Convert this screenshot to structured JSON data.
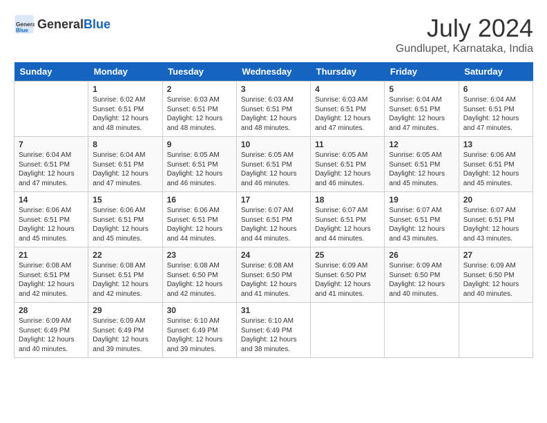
{
  "header": {
    "logo_general": "General",
    "logo_blue": "Blue",
    "month_year": "July 2024",
    "location": "Gundlupet, Karnataka, India"
  },
  "days_of_week": [
    "Sunday",
    "Monday",
    "Tuesday",
    "Wednesday",
    "Thursday",
    "Friday",
    "Saturday"
  ],
  "weeks": [
    [
      {
        "day": "",
        "content": ""
      },
      {
        "day": "1",
        "content": "Sunrise: 6:02 AM\nSunset: 6:51 PM\nDaylight: 12 hours\nand 48 minutes."
      },
      {
        "day": "2",
        "content": "Sunrise: 6:03 AM\nSunset: 6:51 PM\nDaylight: 12 hours\nand 48 minutes."
      },
      {
        "day": "3",
        "content": "Sunrise: 6:03 AM\nSunset: 6:51 PM\nDaylight: 12 hours\nand 48 minutes."
      },
      {
        "day": "4",
        "content": "Sunrise: 6:03 AM\nSunset: 6:51 PM\nDaylight: 12 hours\nand 47 minutes."
      },
      {
        "day": "5",
        "content": "Sunrise: 6:04 AM\nSunset: 6:51 PM\nDaylight: 12 hours\nand 47 minutes."
      },
      {
        "day": "6",
        "content": "Sunrise: 6:04 AM\nSunset: 6:51 PM\nDaylight: 12 hours\nand 47 minutes."
      }
    ],
    [
      {
        "day": "7",
        "content": "Sunrise: 6:04 AM\nSunset: 6:51 PM\nDaylight: 12 hours\nand 47 minutes."
      },
      {
        "day": "8",
        "content": "Sunrise: 6:04 AM\nSunset: 6:51 PM\nDaylight: 12 hours\nand 47 minutes."
      },
      {
        "day": "9",
        "content": "Sunrise: 6:05 AM\nSunset: 6:51 PM\nDaylight: 12 hours\nand 46 minutes."
      },
      {
        "day": "10",
        "content": "Sunrise: 6:05 AM\nSunset: 6:51 PM\nDaylight: 12 hours\nand 46 minutes."
      },
      {
        "day": "11",
        "content": "Sunrise: 6:05 AM\nSunset: 6:51 PM\nDaylight: 12 hours\nand 46 minutes."
      },
      {
        "day": "12",
        "content": "Sunrise: 6:05 AM\nSunset: 6:51 PM\nDaylight: 12 hours\nand 45 minutes."
      },
      {
        "day": "13",
        "content": "Sunrise: 6:06 AM\nSunset: 6:51 PM\nDaylight: 12 hours\nand 45 minutes."
      }
    ],
    [
      {
        "day": "14",
        "content": "Sunrise: 6:06 AM\nSunset: 6:51 PM\nDaylight: 12 hours\nand 45 minutes."
      },
      {
        "day": "15",
        "content": "Sunrise: 6:06 AM\nSunset: 6:51 PM\nDaylight: 12 hours\nand 45 minutes."
      },
      {
        "day": "16",
        "content": "Sunrise: 6:06 AM\nSunset: 6:51 PM\nDaylight: 12 hours\nand 44 minutes."
      },
      {
        "day": "17",
        "content": "Sunrise: 6:07 AM\nSunset: 6:51 PM\nDaylight: 12 hours\nand 44 minutes."
      },
      {
        "day": "18",
        "content": "Sunrise: 6:07 AM\nSunset: 6:51 PM\nDaylight: 12 hours\nand 44 minutes."
      },
      {
        "day": "19",
        "content": "Sunrise: 6:07 AM\nSunset: 6:51 PM\nDaylight: 12 hours\nand 43 minutes."
      },
      {
        "day": "20",
        "content": "Sunrise: 6:07 AM\nSunset: 6:51 PM\nDaylight: 12 hours\nand 43 minutes."
      }
    ],
    [
      {
        "day": "21",
        "content": "Sunrise: 6:08 AM\nSunset: 6:51 PM\nDaylight: 12 hours\nand 42 minutes."
      },
      {
        "day": "22",
        "content": "Sunrise: 6:08 AM\nSunset: 6:51 PM\nDaylight: 12 hours\nand 42 minutes."
      },
      {
        "day": "23",
        "content": "Sunrise: 6:08 AM\nSunset: 6:50 PM\nDaylight: 12 hours\nand 42 minutes."
      },
      {
        "day": "24",
        "content": "Sunrise: 6:08 AM\nSunset: 6:50 PM\nDaylight: 12 hours\nand 41 minutes."
      },
      {
        "day": "25",
        "content": "Sunrise: 6:09 AM\nSunset: 6:50 PM\nDaylight: 12 hours\nand 41 minutes."
      },
      {
        "day": "26",
        "content": "Sunrise: 6:09 AM\nSunset: 6:50 PM\nDaylight: 12 hours\nand 40 minutes."
      },
      {
        "day": "27",
        "content": "Sunrise: 6:09 AM\nSunset: 6:50 PM\nDaylight: 12 hours\nand 40 minutes."
      }
    ],
    [
      {
        "day": "28",
        "content": "Sunrise: 6:09 AM\nSunset: 6:49 PM\nDaylight: 12 hours\nand 40 minutes."
      },
      {
        "day": "29",
        "content": "Sunrise: 6:09 AM\nSunset: 6:49 PM\nDaylight: 12 hours\nand 39 minutes."
      },
      {
        "day": "30",
        "content": "Sunrise: 6:10 AM\nSunset: 6:49 PM\nDaylight: 12 hours\nand 39 minutes."
      },
      {
        "day": "31",
        "content": "Sunrise: 6:10 AM\nSunset: 6:49 PM\nDaylight: 12 hours\nand 38 minutes."
      },
      {
        "day": "",
        "content": ""
      },
      {
        "day": "",
        "content": ""
      },
      {
        "day": "",
        "content": ""
      }
    ]
  ]
}
